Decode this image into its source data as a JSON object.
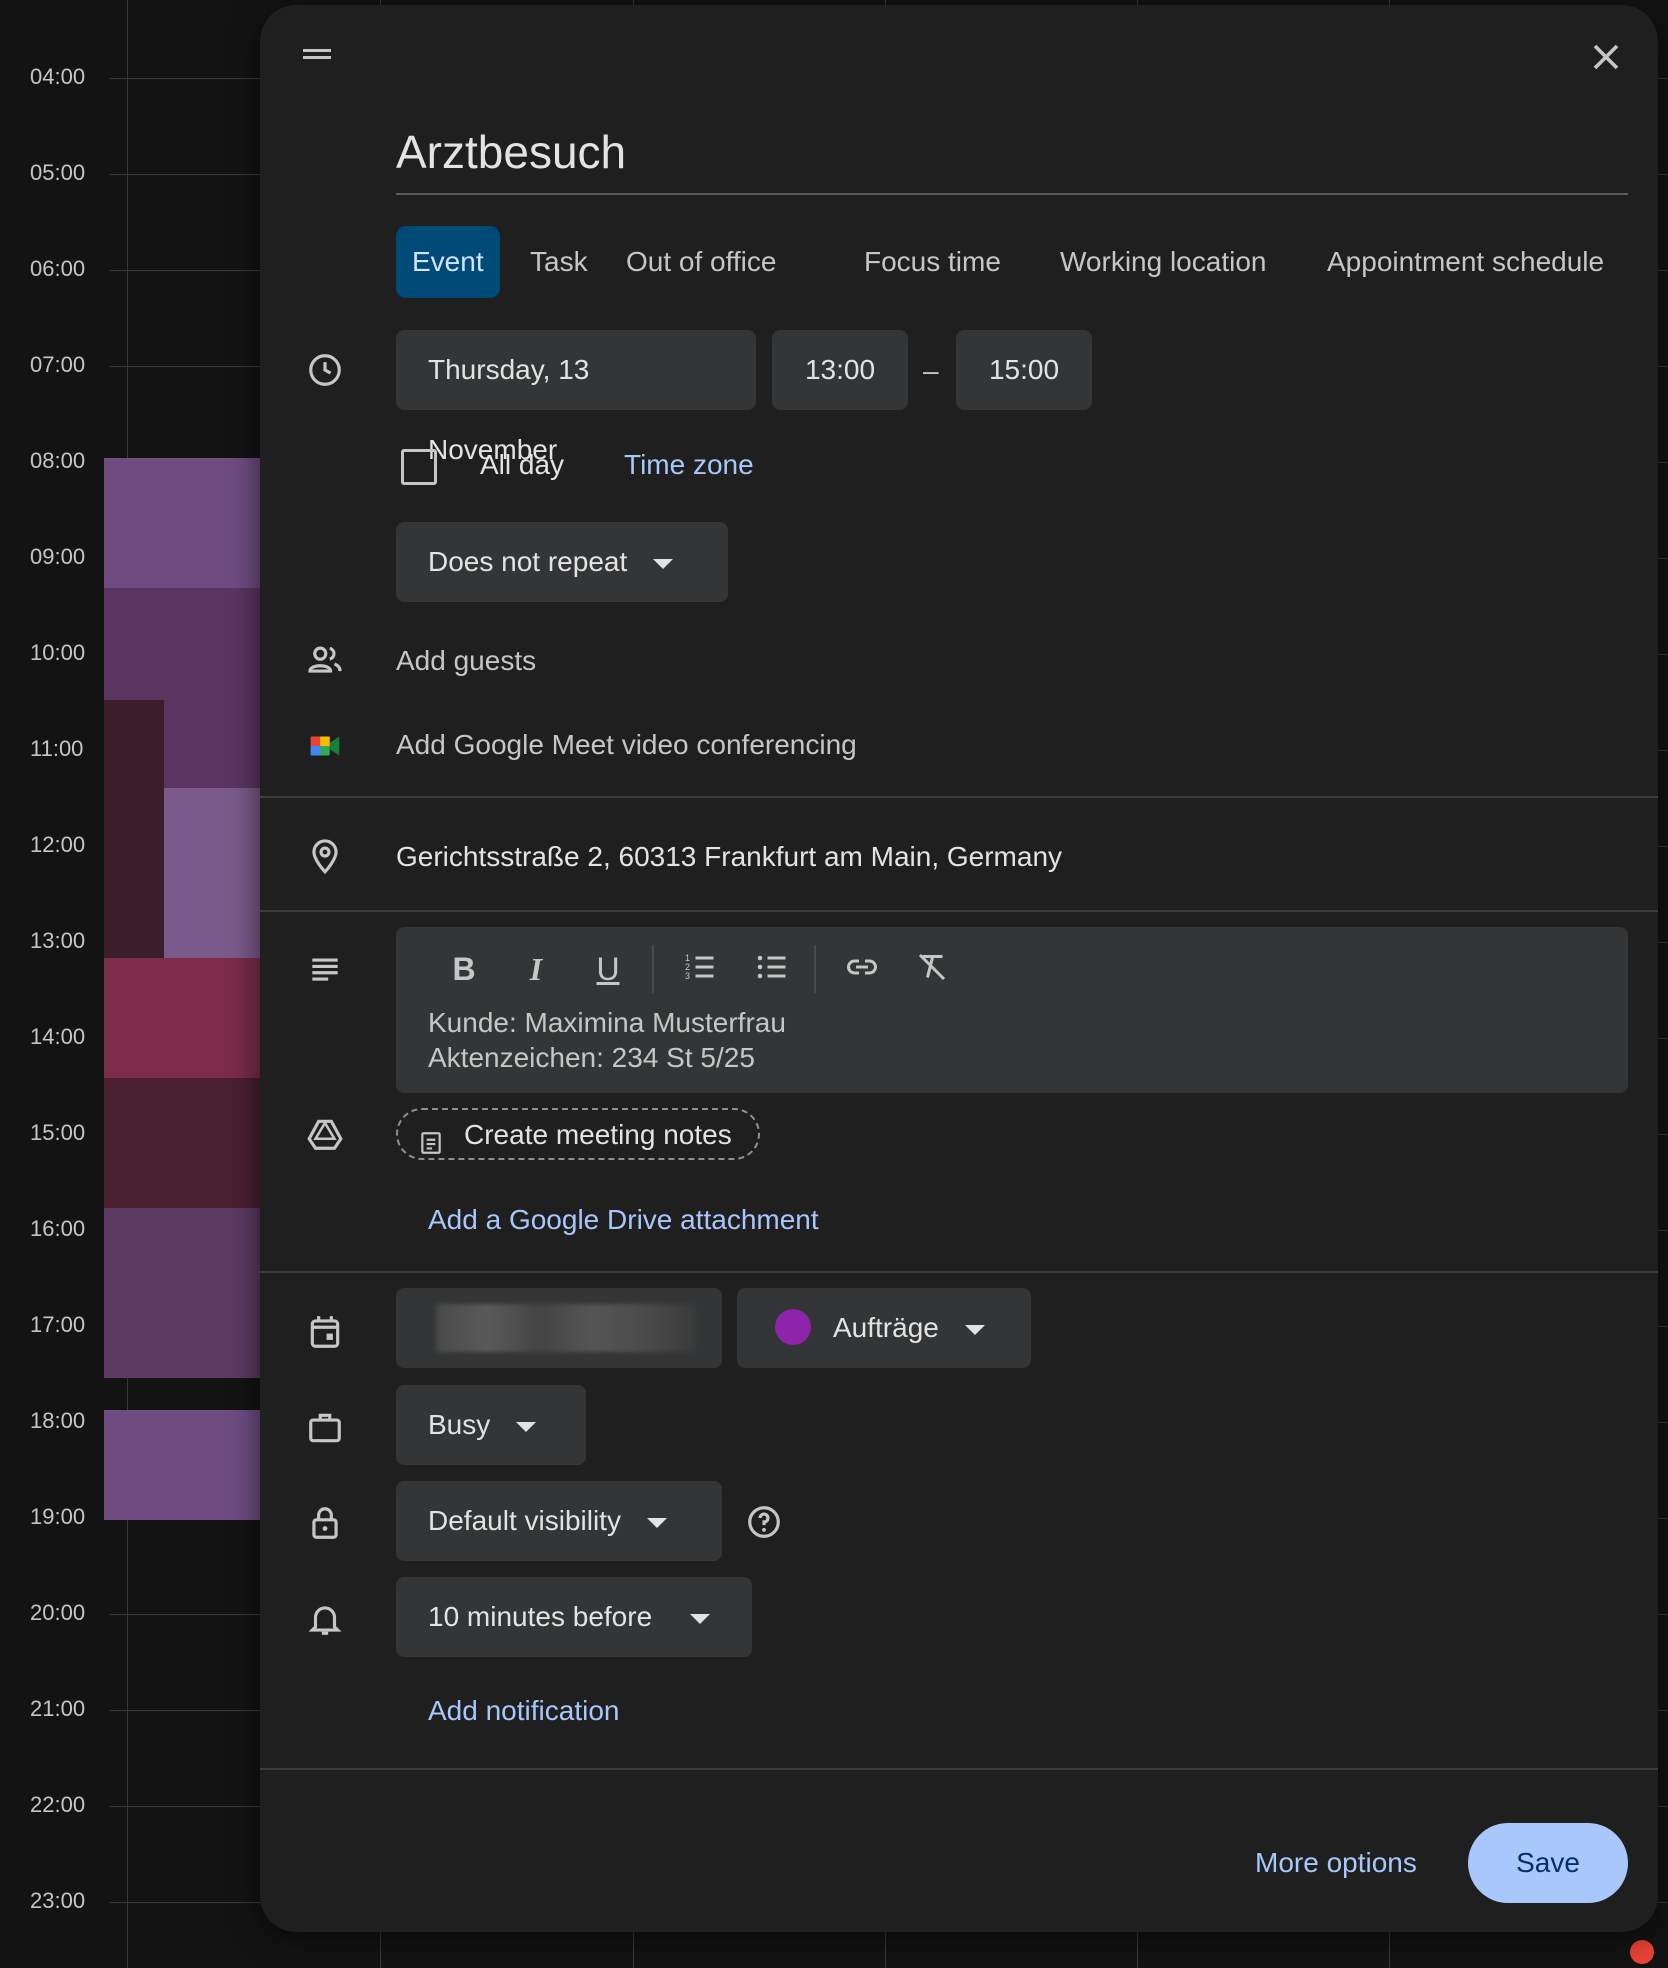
{
  "background": {
    "hours": [
      "04:00",
      "05:00",
      "06:00",
      "07:00",
      "08:00",
      "09:00",
      "10:00",
      "11:00",
      "12:00",
      "13:00",
      "14:00",
      "15:00",
      "16:00",
      "17:00",
      "18:00",
      "19:00",
      "20:00",
      "21:00",
      "22:00",
      "23:00"
    ]
  },
  "dialog": {
    "title": "Arztbesuch",
    "tabs": [
      "Event",
      "Task",
      "Out of office",
      "Focus time",
      "Working location",
      "Appointment schedule"
    ],
    "date": "Thursday, 13 November",
    "start_time": "13:00",
    "dash": "–",
    "end_time": "15:00",
    "all_day": "All day",
    "time_zone": "Time zone",
    "repeat": "Does not repeat",
    "add_guests": "Add guests",
    "meet": "Add Google Meet video conferencing",
    "location": "Gerichtsstraße 2, 60313 Frankfurt am Main, Germany",
    "description_lines": [
      "Kunde: Maximina Musterfrau",
      "Aktenzeichen: 234 St 5/25"
    ],
    "meeting_notes": "Create meeting notes",
    "drive_attachment": "Add a Google Drive attachment",
    "calendar_name": "Aufträge",
    "calendar_color": "#8e24aa",
    "busy": "Busy",
    "visibility": "Default visibility",
    "notification": "10 minutes before",
    "add_notification": "Add notification",
    "more_options": "More options",
    "save": "Save"
  }
}
